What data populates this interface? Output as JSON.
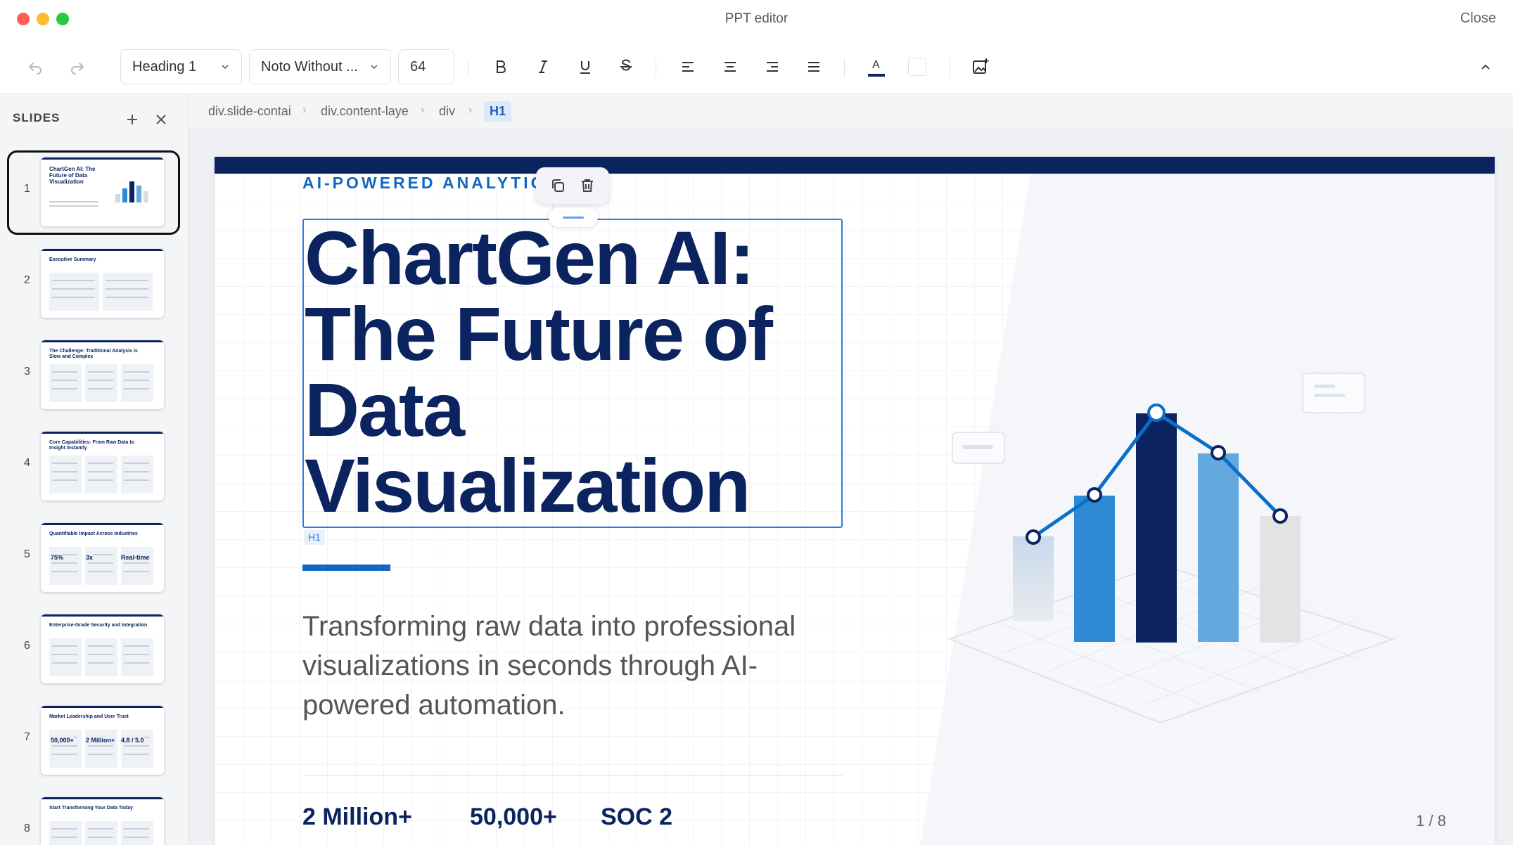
{
  "window": {
    "title": "PPT editor",
    "close_label": "Close"
  },
  "toolbar": {
    "style_value": "Heading 1",
    "font_value": "Noto Without ...",
    "size_value": "64"
  },
  "sidebar": {
    "header": "SLIDES",
    "slides": [
      {
        "num": "1",
        "title": "ChartGen AI: The Future of Data Visualization"
      },
      {
        "num": "2",
        "title": "Executive Summary"
      },
      {
        "num": "3",
        "title": "The Challenge: Traditional Analysis is Slow and Complex"
      },
      {
        "num": "4",
        "title": "Core Capabilities: From Raw Data to Insight Instantly"
      },
      {
        "num": "5",
        "title": "Quantifiable Impact Across Industries"
      },
      {
        "num": "6",
        "title": "Enterprise-Grade Security and Integration"
      },
      {
        "num": "7",
        "title": "Market Leadership and User Trust"
      },
      {
        "num": "8",
        "title": "Start Transforming Your Data Today"
      }
    ]
  },
  "breadcrumb": [
    "div.slide-contai",
    "div.content-laye",
    "div",
    "H1"
  ],
  "slide": {
    "eyebrow": "AI-POWERED ANALYTICS",
    "title_lines": [
      "ChartGen AI:",
      "The Future of",
      "Data",
      "Visualization"
    ],
    "title_tag": "H1",
    "subtitle": "Transforming raw data into professional visualizations in seconds through AI-powered automation.",
    "stats": [
      "2 Million+",
      "50,000+",
      "SOC 2"
    ],
    "pager": "1 / 8"
  },
  "thumb_texts": {
    "s5": [
      "75%",
      "3x",
      "Real-time"
    ],
    "s7": [
      "50,000+",
      "2 Million+",
      "4.8 / 5.0"
    ]
  },
  "colors": {
    "navy": "#0b2460",
    "blue": "#1068c0",
    "selection": "#2f7be0"
  },
  "icons": [
    "undo-icon",
    "redo-icon",
    "chevron-down-icon",
    "bold-icon",
    "italic-icon",
    "underline-icon",
    "strikethrough-icon",
    "align-left-icon",
    "align-center-icon",
    "align-right-icon",
    "justify-icon",
    "text-color-icon",
    "highlight-color-icon",
    "insert-image-icon",
    "collapse-icon",
    "add-icon",
    "close-icon",
    "copy-icon",
    "trash-icon"
  ]
}
